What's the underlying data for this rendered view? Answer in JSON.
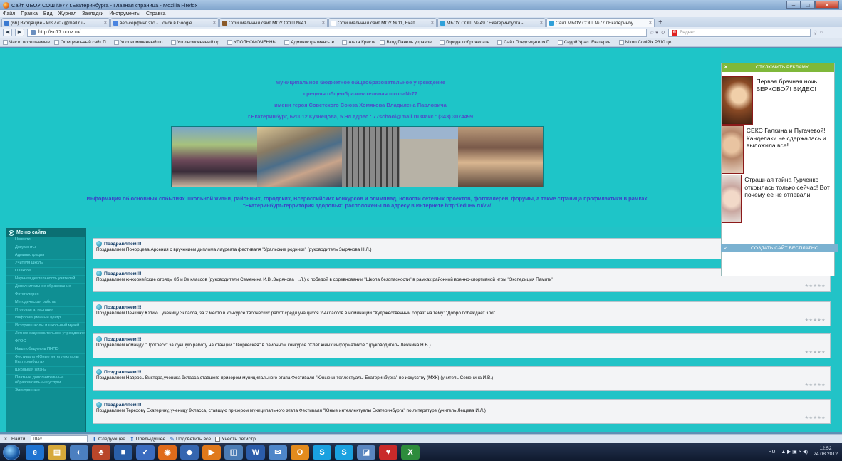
{
  "window": {
    "title": "Сайт МБОУ СОШ №77 г.Екатеринбурга - Главная страница - Mozilla Firefox"
  },
  "menu": [
    "Файл",
    "Правка",
    "Вид",
    "Журнал",
    "Закладки",
    "Инструменты",
    "Справка"
  ],
  "tabs": [
    {
      "label": "(66) Входящие - kris7707@mail.ru - ...",
      "color": "#3a7ad1"
    },
    {
      "label": "веб-серфинг это - Поиск в Google",
      "color": "#4a84e0"
    },
    {
      "label": "Официальный сайт МОУ СОШ №41...",
      "color": "#8a5a2a"
    },
    {
      "label": "Официальный сайт МОУ №11, Екат...",
      "color": "#ffffff"
    },
    {
      "label": "МБОУ СОШ № 49 г.Екатеринбурга -...",
      "color": "#2fa0d9"
    },
    {
      "label": "Сайт МБОУ СОШ №77 г.Екатеринбу...",
      "color": "#2fa0d9"
    }
  ],
  "url": "http://sc77.ucoz.ru/",
  "search_placeholder": "Яндекс",
  "bookmarks": [
    "Часто посещаемые",
    "Официальный сайт П...",
    "Уполномоченный по...",
    "Уполномоченный пр...",
    "УПОЛНОМОЧЕННЫ...",
    "Административно-те...",
    "Агата Кристи",
    "Вход Панель управле...",
    "Города доброжелате...",
    "Сайт Председателя П...",
    "Седой Урал. Екатерин...",
    "Nikon CoolPix P310 це..."
  ],
  "header": {
    "line1": "Муниципальное бюджетное общеобразовательное учреждение",
    "line2": "средняя общеобразовательная школа№77",
    "line3": "имени героя Советского Союза  Хомякова Владилена Павловича",
    "line4": "г.Екатеринбург, 620012  Кузнецова, 5       Эл.адрес : 77school@mail.ru   Факс : (343) 3074499",
    "info1": "Информация об  основных событиях школьной жизни, районных, городских, Всероссийских конкурсов и олимпиад, новости сетевых проектов, фотогалереи, форумы, а также страница профилактики в рамках",
    "info2": "\"Екатеринбург-территория здоровья\" расположены  по адресу  в Интернете http://edu66.ru/77/"
  },
  "sidebar": {
    "title": "Меню сайта",
    "items": [
      "Новости",
      "Документы",
      "Администрация",
      "Учителя школы",
      "О школе",
      "Научная деятельность учителей",
      "Дополнительное образование",
      "Фотогалерея",
      "Методическая работа",
      "Итоговая аттестация",
      "Информационный центр",
      "История школы и школьный музей",
      "Летнее оздоровительное учреждение",
      "ФГОС",
      "Наш победитель ПНПО",
      "Фестиваль «Юные интеллектуалы Екатеринбурга»",
      "Школьная жизнь",
      "Платные дополнительные образовательные услуги",
      "Электронные"
    ]
  },
  "posts": [
    {
      "title": "Поздравляем!!!",
      "text": "Поздравляем Понорцева Арсения с вручением диплома лауреата фестиваля  \"Уральские родники\" (руководитель Зырянова Н.Л.)",
      "rating": "★★★★★"
    },
    {
      "title": "Поздравляем!!!",
      "text": "Поздравляем юнкорнейские отряды 8б и 8е классов (руководители Семенина И.В.,Зырянова Н.Л.) с победой в соревновании  \"Школа безопасности\" в рамках районной военно-спортивной игры  \"Экспедиция Память\"",
      "rating": "★★★★★"
    },
    {
      "title": "Поздравляем!!!",
      "text": "Поздравляем Пенкину Юлию , ученицу 3класса, за 2 место в конкурсе творческих работ среди учащихся  2-4классов в номинации  \"Художественный образ\" на тему:  \"Добро побеждает зло\"",
      "rating": "★★★★★"
    },
    {
      "title": "Поздравляем!!!",
      "text": "Поздравляем команду \"Прогресс\" за лучшую работу на станции \"Творческая\" в районном конкурсе  \"Слет юных информатиков \" (руководитель Лежнина Н.В.)",
      "rating": "★★★★★"
    },
    {
      "title": "Поздравляем!!!",
      "text": "Поздравляем Наврось Виктора,ученика 9класса,ставшего призером муниципального этапа Фестиваля \"Юные интеллектуалы Екатеринбурга\" по искусству (МХК) (учитель Семенина И.В.)",
      "rating": "★★★★★"
    },
    {
      "title": "Поздравляем!!!",
      "text": "Поздравляем Терехову Екатерину, ученицу 9класса, ставшую призером муниципального этапа Фестиваля \"Юные интеллектуалы Екатеринбурга\" по литературе (учитель Лещева И.Л.)",
      "rating": "★★★★★"
    }
  ],
  "ad": {
    "top_label": "ОТКЛЮЧИТЬ РЕКЛАМУ",
    "items": [
      "Первая брачная ночь БЕРКОВОЙ! ВИДЕО!",
      "СЕКС Галкина и Пугачевой! Канделаки не сдержалась и выложила все!",
      "Страшная тайна Гурченко открылась только сейчас! Вот почему ее не отпевали"
    ],
    "bottom_label": "СОЗДАТЬ САЙТ БЕСПЛАТНО"
  },
  "findbar": {
    "label": "Найти:",
    "value": "Шах",
    "next": "Следующее",
    "prev": "Предыдущее",
    "highlight": "Подсветить все",
    "matchcase": "Учесть регистр"
  },
  "taskbar": {
    "lang": "RU",
    "time": "12:52",
    "date": "24.08.2012",
    "apps": [
      {
        "label": "e",
        "color": "#1f73d1"
      },
      {
        "label": "▤",
        "color": "#d7a93a"
      },
      {
        "label": "◐",
        "color": "#4b7fc0"
      },
      {
        "label": "♣",
        "color": "#b9462a"
      },
      {
        "label": "■",
        "color": "#2a5fa8"
      },
      {
        "label": "✓",
        "color": "#3b6cc0"
      },
      {
        "label": "◉",
        "color": "#e06b1b"
      },
      {
        "label": "◆",
        "color": "#3566b0"
      },
      {
        "label": "▶",
        "color": "#e0791b"
      },
      {
        "label": "◫",
        "color": "#4b7cb5"
      },
      {
        "label": "W",
        "color": "#2b5caa"
      },
      {
        "label": "✉",
        "color": "#4e86c9"
      },
      {
        "label": "O",
        "color": "#e38b1d"
      },
      {
        "label": "S",
        "color": "#1aa1e0"
      },
      {
        "label": "S",
        "color": "#1aa1e0"
      },
      {
        "label": "◪",
        "color": "#5a86c0"
      },
      {
        "label": "♥",
        "color": "#c92a2a"
      },
      {
        "label": "X",
        "color": "#2d8c3c"
      }
    ]
  }
}
